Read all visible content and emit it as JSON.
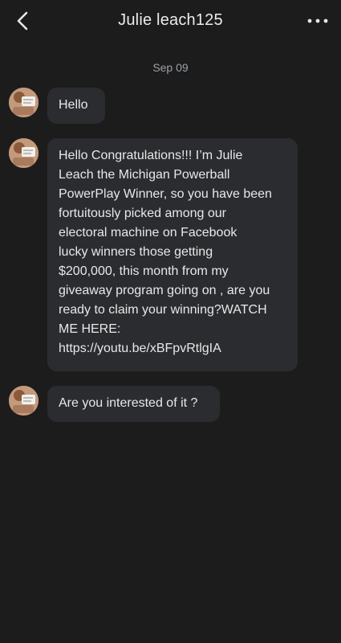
{
  "header": {
    "title": "Julie leach125",
    "back_icon": "chevron-left-icon",
    "more_icon": "more-horizontal-icon"
  },
  "date_separator": "Sep 09",
  "messages": [
    {
      "text": "Hello"
    },
    {
      "text": "Hello Congratulations!!! I’m Julie\nLeach the Michigan Powerball\nPowerPlay Winner, so you have been\nfortuitously picked among our\nelectoral machine on Facebook\nlucky winners those getting\n$200,000, this month from my\ngiveaway program going on , are you\nready to claim your winning?WATCH\nME HERE:\nhttps://youtu.be/xBFpvRtlgIA"
    },
    {
      "text": "Are you interested of it ?"
    }
  ],
  "colors": {
    "background": "#1c1c1c",
    "bubble": "#2b2c2f",
    "text": "#e8e8e8",
    "muted": "#9aa0a6"
  }
}
